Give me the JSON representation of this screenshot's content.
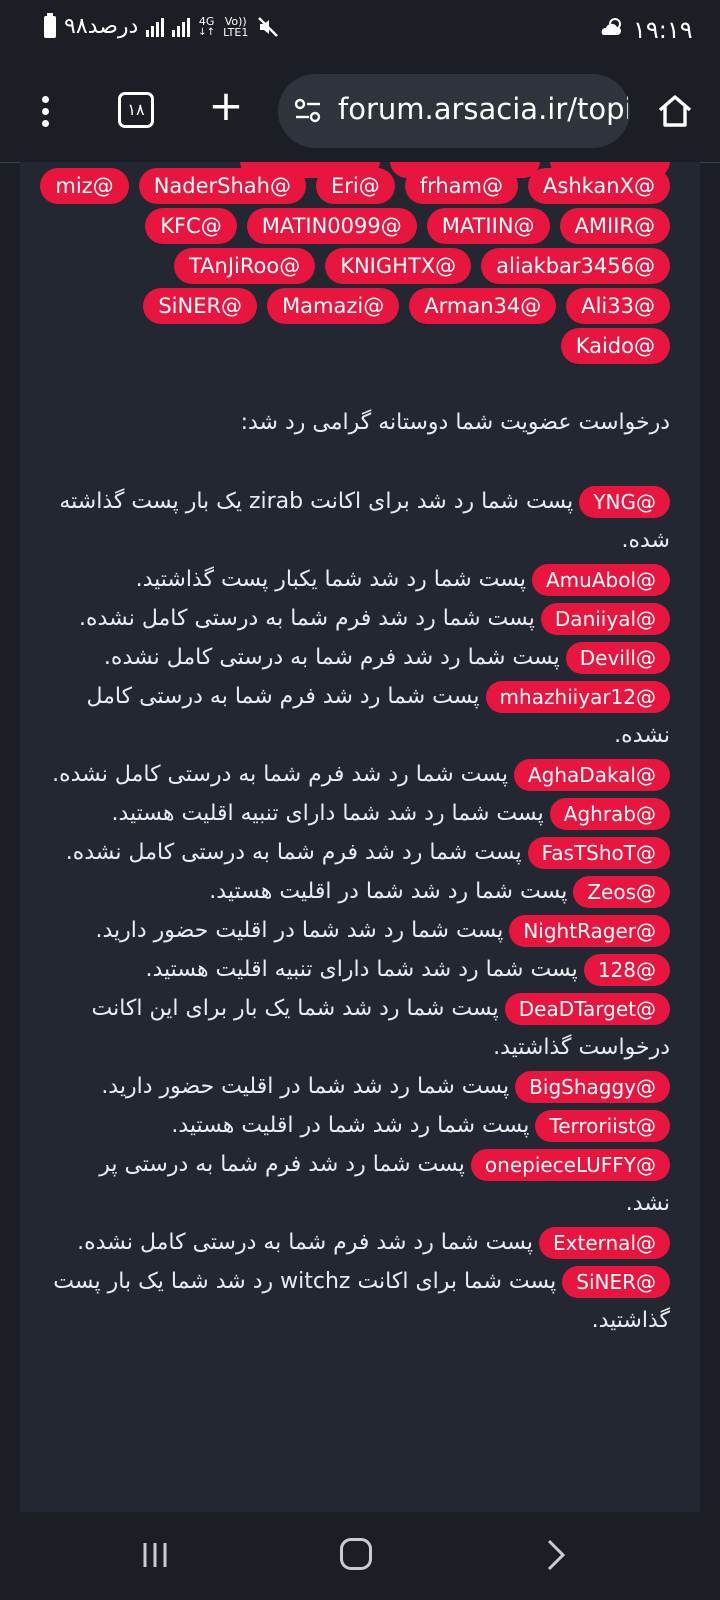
{
  "status_bar": {
    "time": "۱۹:۱۹",
    "battery_text": "۹۸درصد",
    "network_type": "4G",
    "lte_label": "LTE1",
    "volte_label": "Vo))",
    "icons": [
      "battery-icon",
      "signal-icon",
      "signal-icon",
      "mute-icon",
      "weather-icon"
    ]
  },
  "browser": {
    "url": "forum.arsacia.ir/topi",
    "tab_count": "۱۸",
    "icons": [
      "menu-dots-icon",
      "tabs-icon",
      "plus-icon",
      "site-settings-icon",
      "home-icon"
    ]
  },
  "tag_rows": [
    [
      "AshkanX@",
      "frham@",
      "Eri@",
      "NaderShah@",
      "miz@"
    ],
    [
      "AMIIR@",
      "MATIIN@",
      "MATIN0099@",
      "KFC@"
    ],
    [
      "aliakbar3456@",
      "KNIGHTX@",
      "TAnJiRoo@"
    ],
    [
      "Ali33@",
      "Arman34@",
      "Mamazi@",
      "SiNER@"
    ],
    [
      "Kaido@"
    ]
  ],
  "heading": "درخواست عضویت شما دوستانه گرامی رد شد:",
  "reports": [
    {
      "mention": "YNG@",
      "text": "پست شما رد شد برای اکانت zirab یک بار پست گذاشته شده."
    },
    {
      "mention": "AmuAbol@",
      "text": "پست شما رد شد شما یکبار پست گذاشتید."
    },
    {
      "mention": "Daniiyal@",
      "text": "پست شما رد شد فرم شما به درستی کامل نشده."
    },
    {
      "mention": "Devill@",
      "text": "پست شما رد شد فرم شما به درستی کامل نشده."
    },
    {
      "mention": "mhazhiiyar12@",
      "text": "پست شما رد شد فرم شما به درستی کامل نشده."
    },
    {
      "mention": "AghaDakal@",
      "text": "پست شما رد شد فرم شما به درستی کامل نشده."
    },
    {
      "mention": "Aghrab@",
      "text": "پست شما رد شد شما دارای تنبیه اقلیت هستید."
    },
    {
      "mention": "FasTShoT@",
      "text": "پست شما رد شد فرم شما به درستی کامل نشده."
    },
    {
      "mention": "Zeos@",
      "text": "پست شما رد شد شما در اقلیت هستید."
    },
    {
      "mention": "NightRager@",
      "text": "پست شما رد شد شما در اقلیت حضور دارید."
    },
    {
      "mention": "128@",
      "text": "پست شما رد شد شما دارای تنبیه اقلیت هستید."
    },
    {
      "mention": "DeaDTarget@",
      "text": "پست شما رد شد شما یک بار برای این اکانت درخواست گذاشتید."
    },
    {
      "mention": "BigShaggy@",
      "text": "پست شما رد شد شما در اقلیت حضور دارید."
    },
    {
      "mention": "Terroriist@",
      "text": "پست شما رد شد شما در اقلیت هستید."
    },
    {
      "mention": "onepieceLUFFY@",
      "text": "پست شما رد شد فرم شما به درستی پر نشد."
    },
    {
      "mention": "External@",
      "text": "پست شما رد شد فرم شما به درستی کامل نشده."
    },
    {
      "mention": "SiNER@",
      "text": "پست شما برای اکانت witchz رد شد شما یک بار پست گذاشتید."
    }
  ],
  "colors": {
    "mention_bg": "#e8153f",
    "page_bg": "#1b1e25",
    "card_bg": "#232732",
    "url_pill": "#2f333b"
  },
  "nav_bar": {
    "icons": [
      "recent-apps-icon",
      "home-button-icon",
      "back-icon"
    ]
  }
}
